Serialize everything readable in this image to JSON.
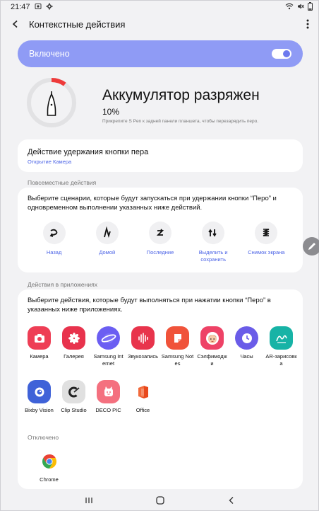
{
  "status": {
    "time": "21:47"
  },
  "header": {
    "title": "Контекстные действия"
  },
  "master_toggle": {
    "label": "Включено",
    "on": true,
    "color": "#8f9bf5"
  },
  "battery": {
    "title": "Аккумулятор разряжен",
    "percent": "10%",
    "level": 0.1,
    "hint": "Прикрепите S Pen к задней панели планшета, чтобы перезарядить перо."
  },
  "hold_action": {
    "title": "Действие удержания кнопки пера",
    "value": "Открытие Камера"
  },
  "global_actions": {
    "section": "Повсеместные действия",
    "description": "Выберите сценарии, которые будут запускаться при удержании кнопки “Перо” и одновременном выполнении указанных ниже действий.",
    "items": [
      {
        "label": "Назад"
      },
      {
        "label": "Домой"
      },
      {
        "label": "Последние"
      },
      {
        "label": "Выделить и сохранить"
      },
      {
        "label": "Снимок экрана"
      }
    ]
  },
  "app_actions": {
    "section": "Действия в приложениях",
    "description": "Выберите действия, которые будут выполняться при нажатии кнопки “Перо” в указанных ниже приложениях.",
    "apps": [
      {
        "label": "Камера",
        "icon": "camera-icon",
        "color": "#ee3e55"
      },
      {
        "label": "Галерея",
        "icon": "gallery-icon",
        "color": "#e8334d"
      },
      {
        "label": "Samsung Internet",
        "icon": "internet-icon",
        "color": "#6b5ef2"
      },
      {
        "label": "Звукозапись",
        "icon": "voice-recorder-icon",
        "color": "#e8344c"
      },
      {
        "label": "Samsung Notes",
        "icon": "notes-icon",
        "color": "#f0533a"
      },
      {
        "label": "Сэлфимоджи",
        "icon": "selfiemoji-icon",
        "color": "#ee4266"
      },
      {
        "label": "Часы",
        "icon": "clock-icon",
        "color": "#6a5ce8"
      },
      {
        "label": "AR-зарисовка",
        "icon": "ar-doodle-icon",
        "color": "#17b3a6"
      },
      {
        "label": "Bixby Vision",
        "icon": "bixby-vision-icon",
        "color": "#3f62d8"
      },
      {
        "label": "Clip Studio",
        "icon": "clip-studio-icon",
        "color": "#e0e0e0"
      },
      {
        "label": "DECO PIC",
        "icon": "deco-pic-icon",
        "color": "#f4707f"
      },
      {
        "label": "Office",
        "icon": "office-icon",
        "color": "#ffffff"
      }
    ],
    "disabled_section": "Отключено",
    "disabled_apps": [
      {
        "label": "Chrome",
        "icon": "chrome-icon"
      }
    ]
  }
}
